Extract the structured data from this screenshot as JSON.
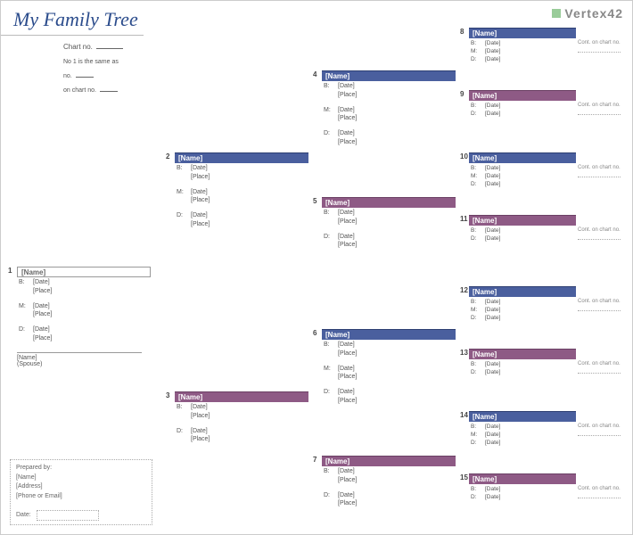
{
  "title": "My Family Tree",
  "logo_text": "Vertex42",
  "meta": {
    "chart_no_label": "Chart no.",
    "note1": "No 1 is the same as",
    "note2": "no.",
    "note3": "on chart no."
  },
  "placeholders": {
    "name": "[Name]",
    "date": "[Date]",
    "place": "[Place]",
    "b": "B:",
    "m": "M:",
    "d": "D:",
    "spouse": "(Spouse)",
    "cont": "Cont. on chart no."
  },
  "prepared": {
    "title": "Prepared by:",
    "name": "[Name]",
    "address": "[Address]",
    "phone": "[Phone or Email]",
    "date_label": "Date:"
  },
  "numbers": {
    "n1": "1",
    "n2": "2",
    "n3": "3",
    "n4": "4",
    "n5": "5",
    "n6": "6",
    "n7": "7",
    "n8": "8",
    "n9": "9",
    "n10": "10",
    "n11": "11",
    "n12": "12",
    "n13": "13",
    "n14": "14",
    "n15": "15"
  }
}
